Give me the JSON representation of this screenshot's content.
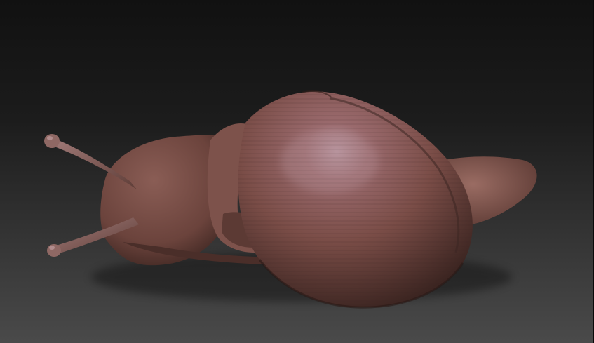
{
  "scene": {
    "subject": "snail",
    "background_top": "#121212",
    "background_bottom": "#4a4a4a",
    "material_color": "#7a4f48",
    "material_highlight": "#b08f98",
    "material_shadow": "#3a2420"
  }
}
